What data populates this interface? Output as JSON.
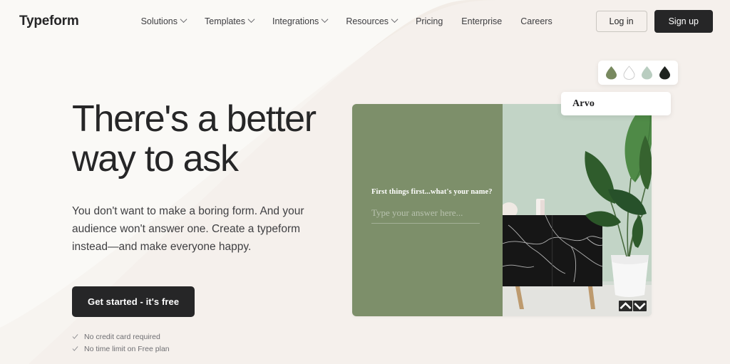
{
  "header": {
    "logo": "Typeform",
    "nav": [
      {
        "label": "Solutions",
        "has_dropdown": true
      },
      {
        "label": "Templates",
        "has_dropdown": true
      },
      {
        "label": "Integrations",
        "has_dropdown": true
      },
      {
        "label": "Resources",
        "has_dropdown": true
      },
      {
        "label": "Pricing",
        "has_dropdown": false
      },
      {
        "label": "Enterprise",
        "has_dropdown": false
      },
      {
        "label": "Careers",
        "has_dropdown": false
      }
    ],
    "login_label": "Log in",
    "signup_label": "Sign up"
  },
  "hero": {
    "headline": "There's a better way to ask",
    "subcopy": "You don't want to make a boring form. And your audience won't answer one. Create a typeform instead—and make everyone happy.",
    "cta_label": "Get started - it's free",
    "perks": [
      "No credit card required",
      "No time limit on Free plan"
    ]
  },
  "preview": {
    "question": "First things first...what's your name?",
    "answer_placeholder": "Type your answer here...",
    "panel_color": "#7d8f6a",
    "prev_arrow_icon": "chevron-up-icon",
    "next_arrow_icon": "chevron-down-icon"
  },
  "widgets": {
    "font_name": "Arvo",
    "swatches": [
      {
        "name": "olive-green",
        "color": "#78895f",
        "outlined": false
      },
      {
        "name": "white",
        "color": "#ffffff",
        "outlined": true
      },
      {
        "name": "pale-sage",
        "color": "#b9cdc0",
        "outlined": false
      },
      {
        "name": "near-black",
        "color": "#1f2420",
        "outlined": false
      }
    ]
  },
  "theme": {
    "background": "#faf9f6",
    "background_accent": "#f2ede8",
    "text_dark": "#262627",
    "button_dark": "#262627"
  }
}
